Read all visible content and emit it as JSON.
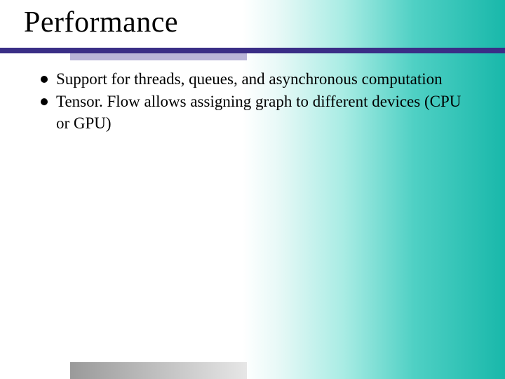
{
  "title": "Performance",
  "bullets": [
    "Support for threads, queues, and asynchronous computation",
    "Tensor. Flow allows assigning graph to different devices (CPU or GPU)"
  ]
}
